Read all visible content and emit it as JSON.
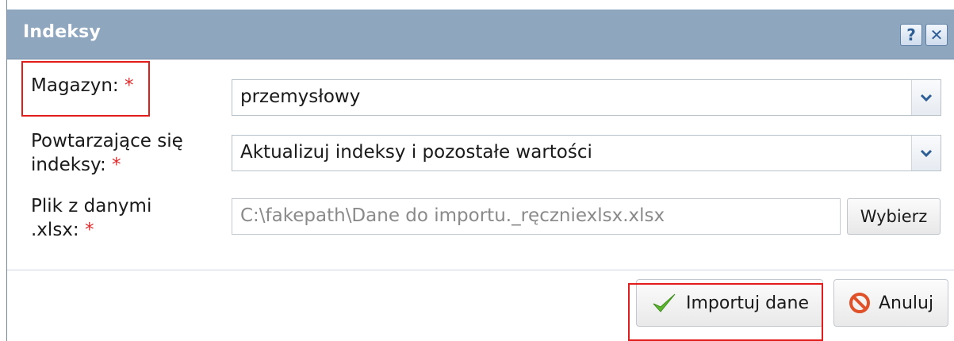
{
  "dialog": {
    "title": "Indeksy",
    "help_icon": "question-icon",
    "close_icon": "close-icon",
    "help_glyph": "?",
    "close_glyph": "✕"
  },
  "form": {
    "warehouse_label": "Magazyn:",
    "warehouse_value": "przemysłowy",
    "duplicates_label_line1": "Powtarzające się",
    "duplicates_label_line2": "indeksy:",
    "duplicates_value": "Aktualizuj indeksy i pozostałe wartości",
    "file_label_line1": "Plik z danymi",
    "file_label_line2": ".xlsx:",
    "file_value": "C:\\fakepath\\Dane do importu._ręczniexlsx.xlsx",
    "pick_button": "Wybierz",
    "required_marker": "*"
  },
  "actions": {
    "import_label": "Importuj dane",
    "cancel_label": "Anuluj",
    "import_icon": "checkmark-icon",
    "cancel_icon": "cancel-icon"
  },
  "colors": {
    "titlebar": "#8ea6be",
    "required": "#e32a2a",
    "highlight": "#e21b1b",
    "accent": "#2d5f96"
  }
}
